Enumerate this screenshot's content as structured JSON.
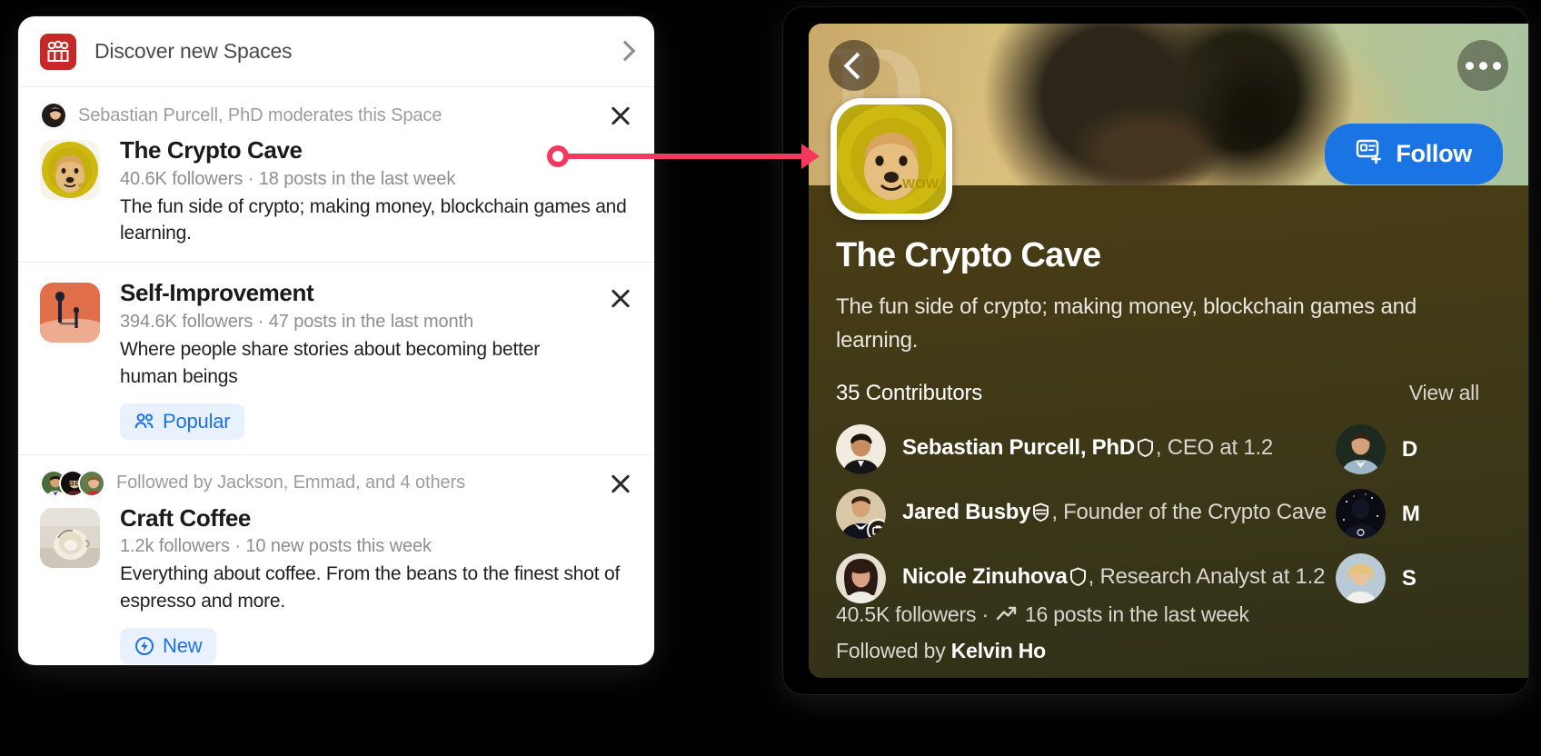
{
  "left_panel": {
    "discover": {
      "label": "Discover new Spaces",
      "icon": "spaces-group-icon",
      "chevron": "chevron-right-icon"
    },
    "spaces": [
      {
        "meta_text": "Sebastian Purcell, PhD moderates this Space",
        "meta_avatars": 1,
        "title": "The Crypto Cave",
        "stats": "40.6K followers · 18 posts in the last week",
        "description": "The fun side of crypto; making money, blockchain games and learning.",
        "badge": null,
        "thumb": "doge-coin-thumb"
      },
      {
        "meta_text": "",
        "meta_avatars": 0,
        "title": "Self-Improvement",
        "stats": "394.6K followers · 47 posts in the last month",
        "description": "Where people share stories about becoming better human beings",
        "badge": {
          "label": "Popular",
          "icon": "people-icon"
        },
        "thumb": "self-improvement-thumb"
      },
      {
        "meta_text": "Followed by Jackson, Emmad, and 4 others",
        "meta_avatars": 3,
        "title": "Craft Coffee",
        "stats": "1.2k followers · 10 new posts this week",
        "description": "Everything about coffee. From the beans to the finest shot of espresso and more.",
        "badge": {
          "label": "New",
          "icon": "new-bolt-icon"
        },
        "thumb": "craft-coffee-thumb"
      }
    ],
    "close_icon": "close-icon"
  },
  "right_panel": {
    "back_icon": "chevron-left-icon",
    "more_icon": "more-options-icon",
    "cover_glyph": "D",
    "follow_button": {
      "label": "Follow",
      "icon": "follow-space-icon",
      "color": "#1b74e4"
    },
    "title": "The Crypto Cave",
    "description": "The fun side of crypto; making money, blockchain games and learning.",
    "contributors_count": "35 Contributors",
    "view_all": "View all",
    "contributors": [
      {
        "name": "Sebastian Purcell, PhD",
        "badge": "shield-icon",
        "role": ", CEO at 1.2",
        "work_badge": false
      },
      {
        "name": "Jared Busby",
        "badge": "shield-check-icon",
        "role": ", Founder of the Crypto Cave",
        "work_badge": true
      },
      {
        "name": "Nicole Zinuhova",
        "badge": "shield-icon",
        "role": ", Research Analyst at 1.2",
        "work_badge": false
      }
    ],
    "contributors_column2": [
      {
        "name": "D",
        "role": ""
      },
      {
        "name": "M",
        "role": ""
      },
      {
        "name": "S",
        "role": ""
      }
    ],
    "footer_stats": "40.5K followers ·",
    "footer_stats_posts": "16 posts in the last week",
    "footer_trend_icon": "trend-up-icon",
    "footer_followed_prefix": "Followed by ",
    "footer_followed_name": "Kelvin Ho"
  },
  "annotation": {
    "color": "#f5395e",
    "type": "arrow-connector"
  }
}
